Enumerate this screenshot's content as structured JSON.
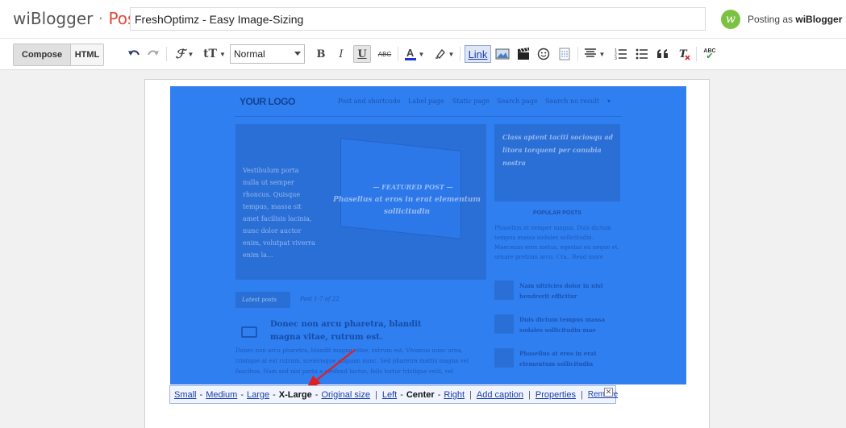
{
  "header": {
    "brand_name": "wiBlogger",
    "brand_sep": " · ",
    "brand_section": "Post",
    "post_title_value": "FreshOptimz - Easy Image-Sizing",
    "avatar_glyph": "w",
    "posting_as_prefix": "Posting as ",
    "posting_as_user": "wiBlogger",
    "colors": {
      "brand_section": "#dd4b39",
      "avatar": "#7cc242"
    }
  },
  "toolbar": {
    "compose_label": "Compose",
    "html_label": "HTML",
    "undo_icon": "undo-icon",
    "redo_icon": "redo-icon",
    "font_icon": "font-family-icon",
    "font_size_icon": "font-size-icon",
    "format_value": "Normal",
    "bold": "B",
    "italic": "I",
    "underline": "U",
    "strikethrough": "ABC",
    "text_color": "A",
    "link_label": "Link",
    "icons": [
      "highlight-icon",
      "insert-image-icon",
      "insert-video-icon",
      "emoji-icon",
      "jump-break-icon",
      "align-icon",
      "numbered-list-icon",
      "bulleted-list-icon",
      "quote-icon",
      "remove-formatting-icon",
      "spellcheck-icon"
    ],
    "spell_label": "ABC"
  },
  "preview": {
    "logo": "YOUR LOGO",
    "nav": [
      "Post and shortcode",
      "Label page",
      "Static page",
      "Search page",
      "Search no result",
      "▾"
    ],
    "featured_left_text": "Vestibulum porta nulla ut semper rhoncus. Quisque tempus, massa sit amet facilisis lacinia, nunc dolor auctor enim, volutpat viverra enim la...",
    "featured_label": "— FEATURED POST —",
    "featured_title": "Phasellus at eros in erat elementum sollicitudin",
    "side_caption": "Class aptent taciti sociosqu ad litora torquent per conubia nostra",
    "popular_heading": "POPULAR POSTS",
    "popular_body": "Phasellus at semper magna. Duis dictum tempus massa sodales sollicitudin. Maecenas eros metus, egestas eu neque et, ornare pretium arcu. Cra.. Read more",
    "popular_items": [
      "Nam ultricies dolor in nisl hendrerit efficitur",
      "Duis dictum tempus massa sodales sollicitudin mae",
      "Phasellus at eros in erat elementum sollicitudin"
    ],
    "latest_tag": "Latest posts",
    "latest_count": "Post 1-7 of 22",
    "post_title": "Donec non arcu pharetra, blandit magna vitae, rutrum est.",
    "post_body": "Donec non arcu pharetra, blandit magna vitae, rutrum est. Vivamus nunc urna, tristique at est rutrum, scelerisque aliquam nunc. Sed pharetra mattis magna vel faucibus. Nam sed nisi porta a eleifend luctus, felis tortor tristique velit, vel"
  },
  "image_bubble": {
    "small": "Small",
    "medium": "Medium",
    "large": "Large",
    "xlarge": "X-Large",
    "original": "Original size",
    "left": "Left",
    "center": "Center",
    "right": "Right",
    "add_caption": "Add caption",
    "properties": "Properties",
    "remove": "Remove",
    "close_glyph": "✕",
    "dash": "-",
    "bar": "|"
  },
  "colors": {
    "selection_overlay": "#2f7ff1",
    "link": "#1a3ea8",
    "arrow": "#e0201e"
  }
}
